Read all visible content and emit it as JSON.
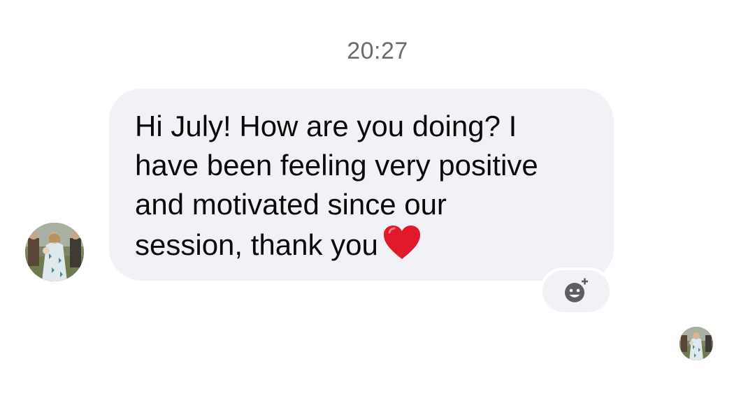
{
  "thread": {
    "timestamp": "20:27"
  },
  "message": {
    "text": "Hi July! How are you doing? I\nhave been feeling very positive\nand motivated since our\nsession, thank you",
    "emoji": "red-heart",
    "direction": "incoming"
  },
  "actions": {
    "react_icon": "add-reaction-icon"
  },
  "colors": {
    "bubble_bg": "#f1f2f6",
    "timestamp": "#6b6b70",
    "text": "#0a0a0a",
    "heart": "#e0192b",
    "icon": "#5c5e63"
  }
}
